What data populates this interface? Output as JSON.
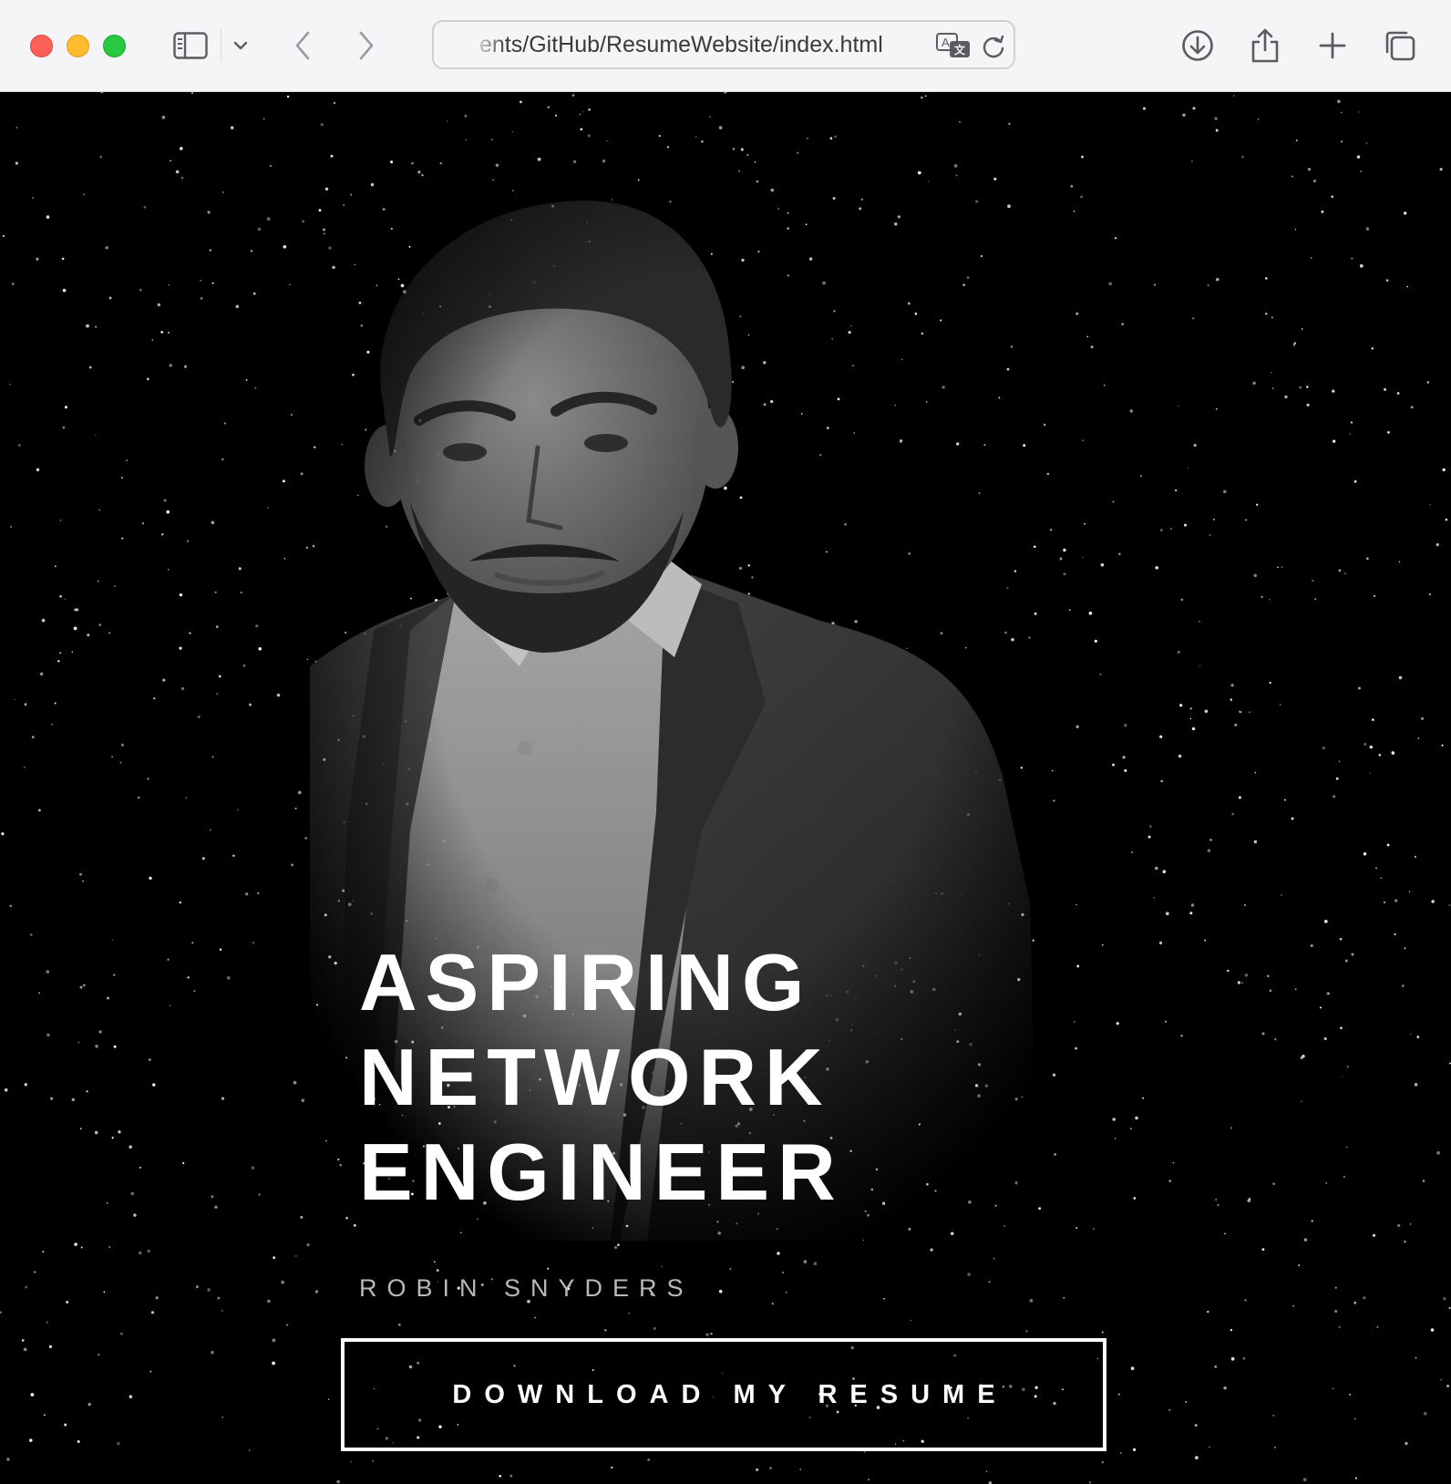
{
  "browser": {
    "url": "ents/GitHub/ResumeWebsite/index.html",
    "icons": {
      "sidebar": "sidebar-icon",
      "sidebar_menu": "chevron-down-icon",
      "back": "chevron-left-icon",
      "forward": "chevron-right-icon",
      "translate": "translate-icon",
      "reload": "reload-icon",
      "downloads": "download-icon",
      "share": "share-icon",
      "new_tab": "plus-icon",
      "tab_overview": "tabs-icon"
    }
  },
  "hero": {
    "title_lines": [
      "ASPIRING",
      "NETWORK",
      "ENGINEER"
    ],
    "name": "ROBIN SNYDERS",
    "cta_label": "DOWNLOAD MY RESUME"
  },
  "colors": {
    "background": "#000000",
    "text": "#ffffff",
    "name_text": "#b9b9b9"
  }
}
